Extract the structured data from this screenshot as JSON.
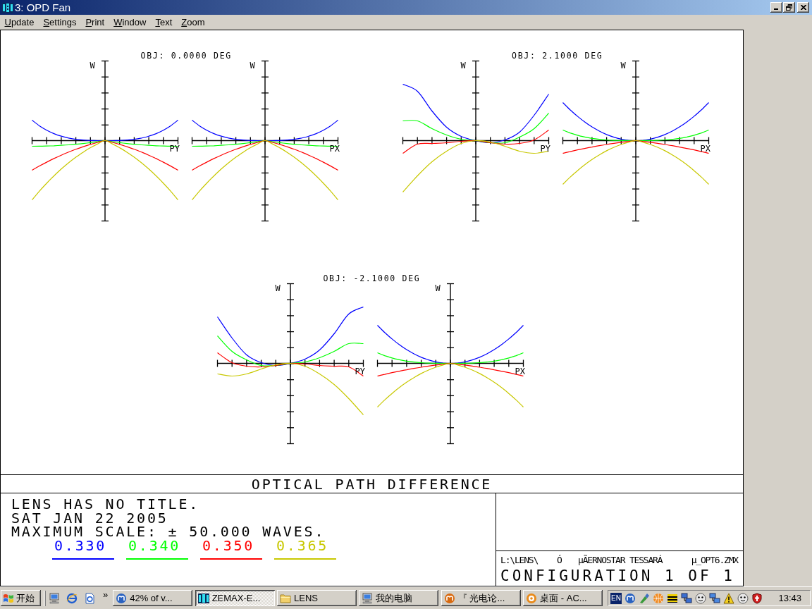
{
  "window": {
    "title": "3: OPD Fan"
  },
  "menu": [
    "Update",
    "Settings",
    "Print",
    "Window",
    "Text",
    "Zoom"
  ],
  "plots": [
    {
      "title": "OBJ: 0.0000 DEG",
      "fans": [
        {
          "vertical_label": "W",
          "horizontal_label": "PY"
        },
        {
          "vertical_label": "W",
          "horizontal_label": "PX"
        }
      ]
    },
    {
      "title": "OBJ: 2.1000 DEG",
      "fans": [
        {
          "vertical_label": "W",
          "horizontal_label": "PY"
        },
        {
          "vertical_label": "W",
          "horizontal_label": "PX"
        }
      ]
    },
    {
      "title": "OBJ: -2.1000 DEG",
      "fans": [
        {
          "vertical_label": "W",
          "horizontal_label": "PY"
        },
        {
          "vertical_label": "W",
          "horizontal_label": "PX"
        }
      ]
    }
  ],
  "caption": "OPTICAL PATH DIFFERENCE",
  "info": {
    "lines": [
      "LENS HAS NO TITLE.",
      "SAT JAN 22 2005",
      "MAXIMUM SCALE: ± 50.000 WAVES."
    ],
    "wavelengths": [
      {
        "label": "0.330",
        "color": "#0000ff"
      },
      {
        "label": "0.340",
        "color": "#00ff00"
      },
      {
        "label": "0.350",
        "color": "#ff0000"
      },
      {
        "label": "0.365",
        "color": "#c8c800"
      }
    ]
  },
  "file_info": {
    "path": "L:\\LENS\\",
    "marker": "Ó",
    "lens_name": "µÃERNOSTAR TESSARÁ",
    "file": "µ_OPT6.ZMX",
    "configuration": "CONFIGURATION 1 OF 1"
  },
  "taskbar": {
    "start": "开始",
    "more": "»",
    "tasks": [
      {
        "label": "42% of v...",
        "kind": "badge",
        "selected": false
      },
      {
        "label": "ZEMAX-E...",
        "kind": "app",
        "selected": true
      },
      {
        "label": "LENS",
        "kind": "folder",
        "selected": false
      },
      {
        "label": "我的电脑",
        "kind": "computer",
        "selected": false
      },
      {
        "label": "『 光电论...",
        "kind": "forum",
        "selected": false
      },
      {
        "label": "桌面 - AC...",
        "kind": "disc",
        "selected": false
      }
    ],
    "language": "EN",
    "clock": "13:43"
  }
}
